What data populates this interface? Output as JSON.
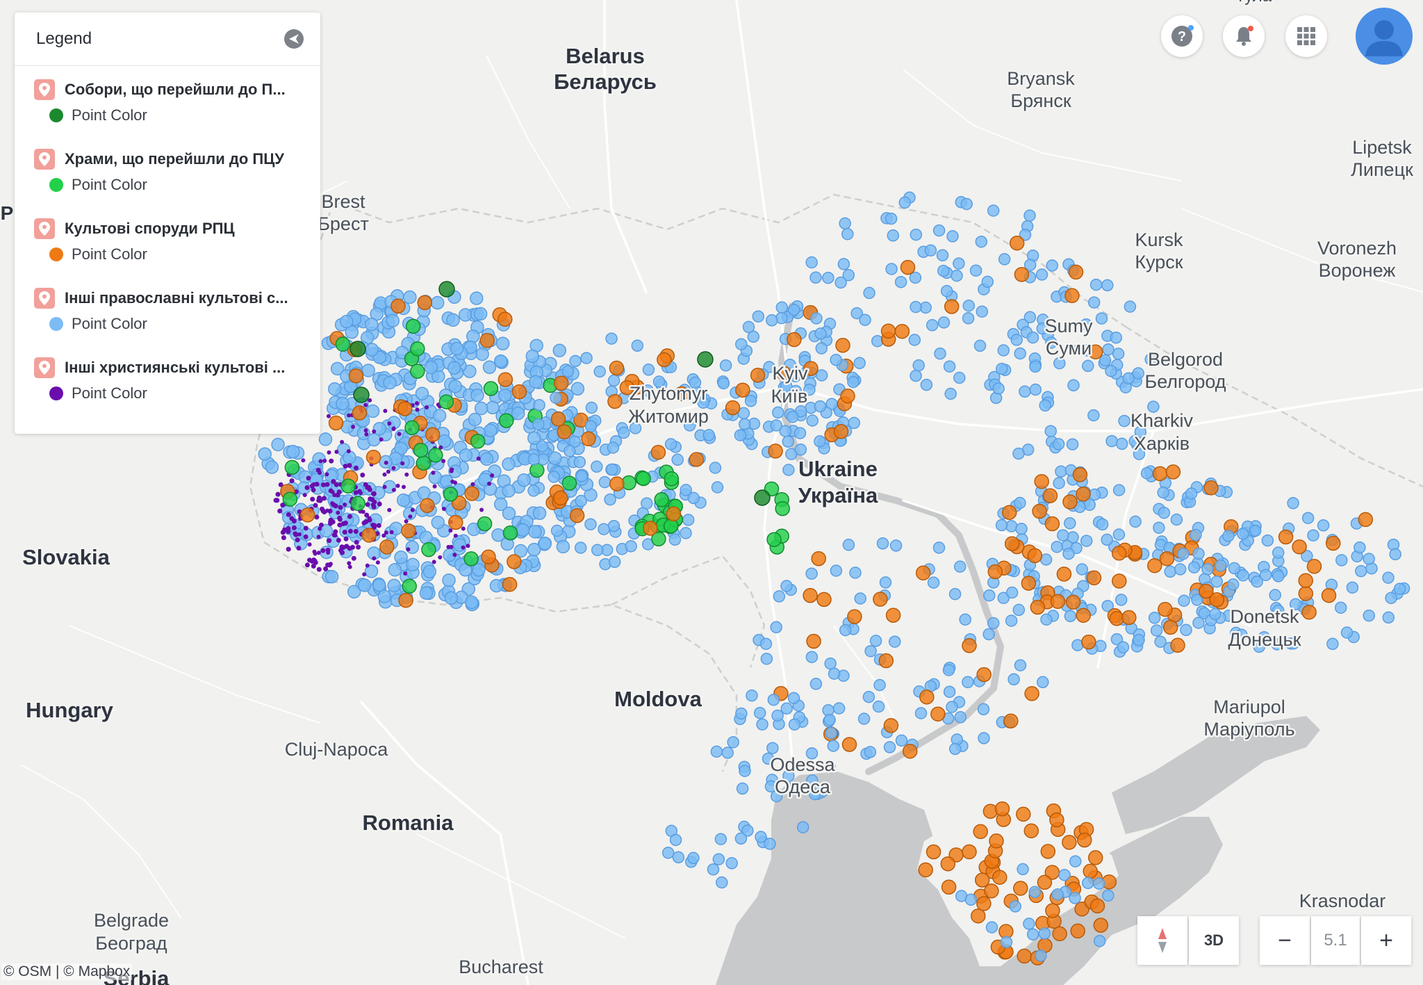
{
  "legend": {
    "title": "Legend",
    "layers": [
      {
        "name": "Собори, що перейшли до П...",
        "point_label": "Point Color",
        "color": "#1b8a2e"
      },
      {
        "name": "Храми, що перейшли до ПЦУ",
        "point_label": "Point Color",
        "color": "#22d04a"
      },
      {
        "name": "Культові споруди РПЦ",
        "point_label": "Point Color",
        "color": "#ef7a13"
      },
      {
        "name": "Інші православні культові с...",
        "point_label": "Point Color",
        "color": "#7bbcf5"
      },
      {
        "name": "Інші християнські культові ...",
        "point_label": "Point Color",
        "color": "#6a0dad"
      }
    ]
  },
  "labels": {
    "belarus_en": "Belarus",
    "belarus_local": "Беларусь",
    "bryansk_en": "Bryansk",
    "bryansk_local": "Брянск",
    "lipetsk_en": "Lipetsk",
    "lipetsk_local": "Липецк",
    "kursk_en": "Kursk",
    "kursk_local": "Курск",
    "voronezh_en": "Voronezh",
    "voronezh_local": "Воронеж",
    "brest_en": "Brest",
    "brest_local": "Брест",
    "sumy_en": "Sumy",
    "sumy_local": "Суми",
    "belgorod_en": "Belgorod",
    "belgorod_local": "Белгород",
    "kyiv_en": "Kyiv",
    "kyiv_local": "Київ",
    "zhytomyr_en": "Zhytomyr",
    "zhytomyr_local": "Житомир",
    "kharkiv_en": "Kharkiv",
    "kharkiv_local": "Харків",
    "ukraine_en": "Ukraine",
    "ukraine_local": "Україна",
    "slovakia": "Slovakia",
    "hungary": "Hungary",
    "moldova": "Moldova",
    "donetsk_en": "Donetsk",
    "donetsk_local": "Донецьк",
    "mariupol_en": "Mariupol",
    "mariupol_local": "Маріуполь",
    "cluj": "Cluj-Napoca",
    "odessa_en": "Odessa",
    "odessa_local": "Одеса",
    "romania": "Romania",
    "krasnodar": "Krasnodar",
    "belgrade_en": "Belgrade",
    "belgrade_local": "Београд",
    "bucharest": "Bucharest",
    "serbia_partial": "Serbia",
    "tula_partial": "Тула",
    "poland_partial": "P"
  },
  "controls": {
    "compass_label": "3D",
    "zoom_level": "5.1",
    "zoom_out": "−",
    "zoom_in": "+",
    "help_icon": "help-icon",
    "bell_icon": "bell-icon",
    "apps_icon": "apps-grid-icon"
  },
  "attribution": "© OSM | © Mapbox",
  "colors": {
    "land": "#f1f1ef",
    "water": "#c5c7c9",
    "road": "#ffffff",
    "border": "#c9c9c9"
  }
}
